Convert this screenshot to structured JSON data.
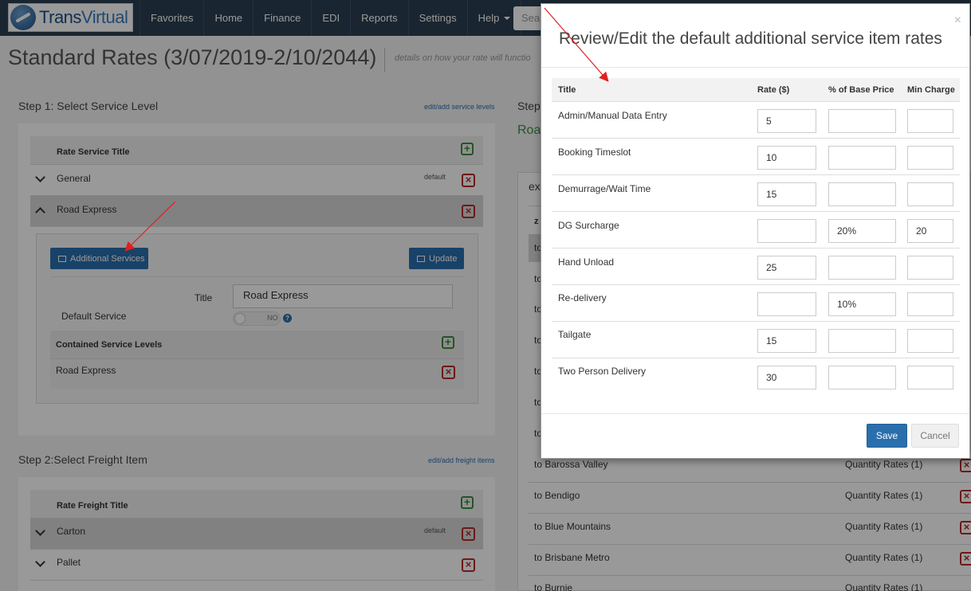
{
  "navbar": {
    "brand": {
      "part1": "Trans",
      "part2": "Virtual"
    },
    "items": [
      {
        "label": "Favorites"
      },
      {
        "label": "Home"
      },
      {
        "label": "Finance"
      },
      {
        "label": "EDI"
      },
      {
        "label": "Reports"
      },
      {
        "label": "Settings"
      },
      {
        "label": "Help"
      }
    ],
    "search_text": "Sea"
  },
  "page": {
    "title": "Standard Rates (3/07/2019-2/10/2044)",
    "subtitle": "details on how your rate will functio"
  },
  "step1": {
    "heading": "Step 1: Select Service Level",
    "link": "edit/add service levels",
    "table_header": "Rate Service Title",
    "rows": [
      {
        "title": "General",
        "badge": "default"
      },
      {
        "title": "Road Express",
        "badge": ""
      }
    ],
    "detail": {
      "additional_services_label": "Additional Services",
      "update_label": "Update",
      "title_label": "Title",
      "title_value": "Road Express",
      "default_service_label": "Default Service",
      "toggle_text": "NO",
      "help_icon_text": "?",
      "contained_header": "Contained Service Levels",
      "contained_rows": [
        {
          "title": "Road Express"
        }
      ]
    }
  },
  "step2": {
    "heading": "Step 2:Select Freight Item",
    "link": "edit/add freight items",
    "table_header": "Rate Freight Title",
    "rows": [
      {
        "title": "Carton",
        "badge": "default"
      },
      {
        "title": "Pallet",
        "badge": ""
      }
    ]
  },
  "right_panel": {
    "step_label": "Step",
    "subtitle": "Roa",
    "tab": "ex",
    "col_prefix": "z",
    "partial_rows": [
      "to",
      "to",
      "to",
      "to",
      "to",
      "to",
      "to"
    ],
    "routes": [
      {
        "name": "to Barossa Valley",
        "rate": "Quantity Rates (1)"
      },
      {
        "name": "to Bendigo",
        "rate": "Quantity Rates (1)"
      },
      {
        "name": "to Blue Mountains",
        "rate": "Quantity Rates (1)"
      },
      {
        "name": "to Brisbane Metro",
        "rate": "Quantity Rates (1)"
      },
      {
        "name": "to Burnie",
        "rate": "Quantity Rates (1)"
      }
    ]
  },
  "modal": {
    "close_glyph": "×",
    "title": "Review/Edit the default additional service item rates",
    "columns": {
      "title": "Title",
      "rate": "Rate ($)",
      "pct": "% of Base Price",
      "min": "Min Charge"
    },
    "rows": [
      {
        "title": "Admin/Manual Data Entry",
        "rate": "5",
        "pct": "",
        "min": ""
      },
      {
        "title": "Booking Timeslot",
        "rate": "10",
        "pct": "",
        "min": ""
      },
      {
        "title": "Demurrage/Wait Time",
        "rate": "15",
        "pct": "",
        "min": ""
      },
      {
        "title": "DG Surcharge",
        "rate": "",
        "pct": "20%",
        "min": "20"
      },
      {
        "title": "Hand Unload",
        "rate": "25",
        "pct": "",
        "min": ""
      },
      {
        "title": "Re-delivery",
        "rate": "",
        "pct": "10%",
        "min": ""
      },
      {
        "title": "Tailgate",
        "rate": "15",
        "pct": "",
        "min": ""
      },
      {
        "title": "Two Person Delivery",
        "rate": "30",
        "pct": "",
        "min": ""
      }
    ],
    "save_label": "Save",
    "cancel_label": "Cancel"
  },
  "colors": {
    "navbar": "#2b3e50",
    "primary": "#2a6fad",
    "danger": "#b52b27",
    "success": "#3c8d3c",
    "annotation_arrow": "#e02020"
  },
  "icons": [
    "plus-icon",
    "remove-icon",
    "chevron-down-icon",
    "chevron-up-icon",
    "list-icon",
    "save-icon",
    "help-icon",
    "close-icon"
  ]
}
